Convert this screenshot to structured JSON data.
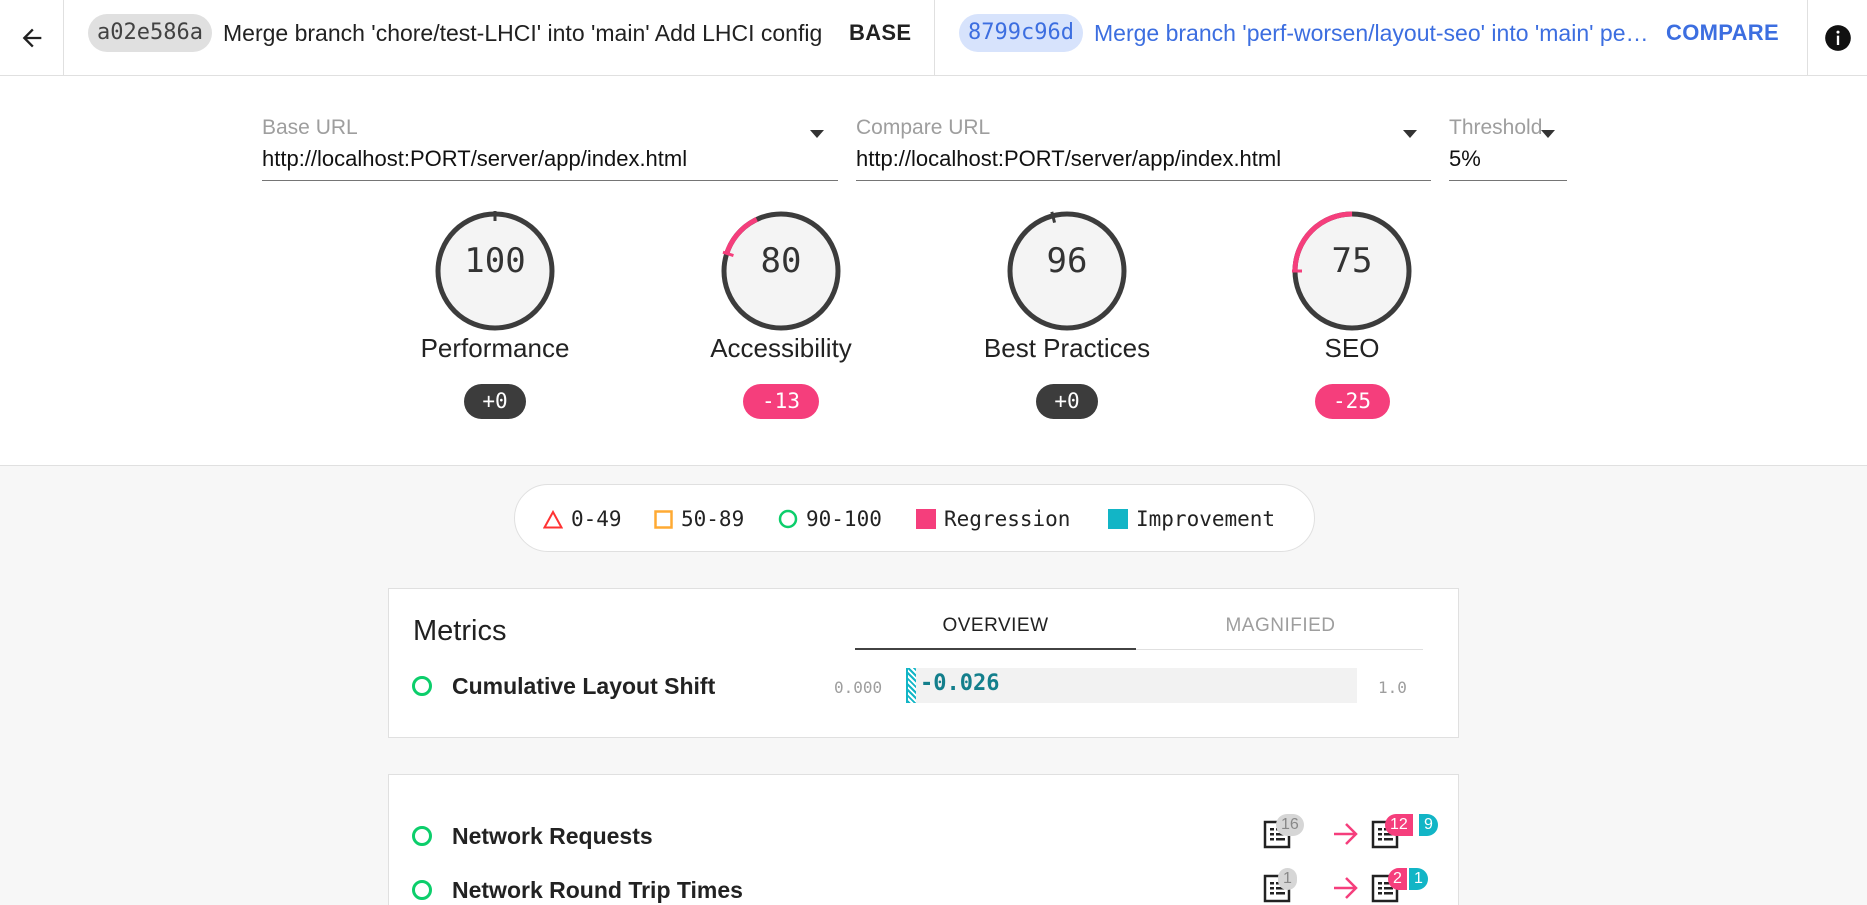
{
  "header": {
    "base": {
      "hash": "a02e586a",
      "message": "Merge branch 'chore/test-LHCI' into 'main' Add LHCI config",
      "tag": "BASE"
    },
    "compare": {
      "hash": "8799c96d",
      "message": "Merge branch 'perf-worsen/layout-seo' into 'main' perf worsen layout seo",
      "tag": "COMPARE"
    },
    "icons": {
      "back": "arrow-left-icon",
      "info": "info-icon"
    }
  },
  "fields": {
    "base_url": {
      "label": "Base URL",
      "value": "http://localhost:PORT/server/app/index.html"
    },
    "compare_url": {
      "label": "Compare URL",
      "value": "http://localhost:PORT/server/app/index.html"
    },
    "threshold": {
      "label": "Threshold",
      "value": "5%"
    }
  },
  "gauges": [
    {
      "score": "100",
      "label": "Performance",
      "delta": "+0",
      "fraction": 1.0,
      "prev_fraction": 1.0
    },
    {
      "score": "80",
      "label": "Accessibility",
      "delta": "-13",
      "fraction": 0.8,
      "prev_fraction": 0.93
    },
    {
      "score": "96",
      "label": "Best Practices",
      "delta": "+0",
      "fraction": 0.96,
      "prev_fraction": 0.96
    },
    {
      "score": "75",
      "label": "SEO",
      "delta": "-25",
      "fraction": 0.75,
      "prev_fraction": 1.0
    }
  ],
  "legend": [
    {
      "label": "0-49",
      "icon": "triangle-icon",
      "color": "#f33"
    },
    {
      "label": "50-89",
      "icon": "square-icon",
      "color": "#fa3"
    },
    {
      "label": "90-100",
      "icon": "circle-icon",
      "color": "#0cce6b"
    },
    {
      "label": "Regression",
      "icon": "regression-swatch",
      "color": "#f53e7c"
    },
    {
      "label": "Improvement",
      "icon": "improvement-swatch",
      "color": "#12b5c6"
    }
  ],
  "metrics": {
    "title": "Metrics",
    "tabs": {
      "overview": "OVERVIEW",
      "magnified": "MAGNIFIED"
    },
    "rows": [
      {
        "label": "Cumulative Layout Shift",
        "min": "0.000",
        "max": "1.0",
        "value": "-0.026",
        "fraction": 0.026
      }
    ]
  },
  "audits": [
    {
      "label": "Network Requests",
      "base_count": "16",
      "regressions": "12",
      "improvements": "9"
    },
    {
      "label": "Network Round Trip Times",
      "base_count": "1",
      "regressions": "2",
      "improvements": "1"
    }
  ],
  "colors": {
    "regression": "#f53e7c",
    "improvement": "#12b5c6",
    "pass": "#0cce6b",
    "link": "#3c6ee0"
  }
}
